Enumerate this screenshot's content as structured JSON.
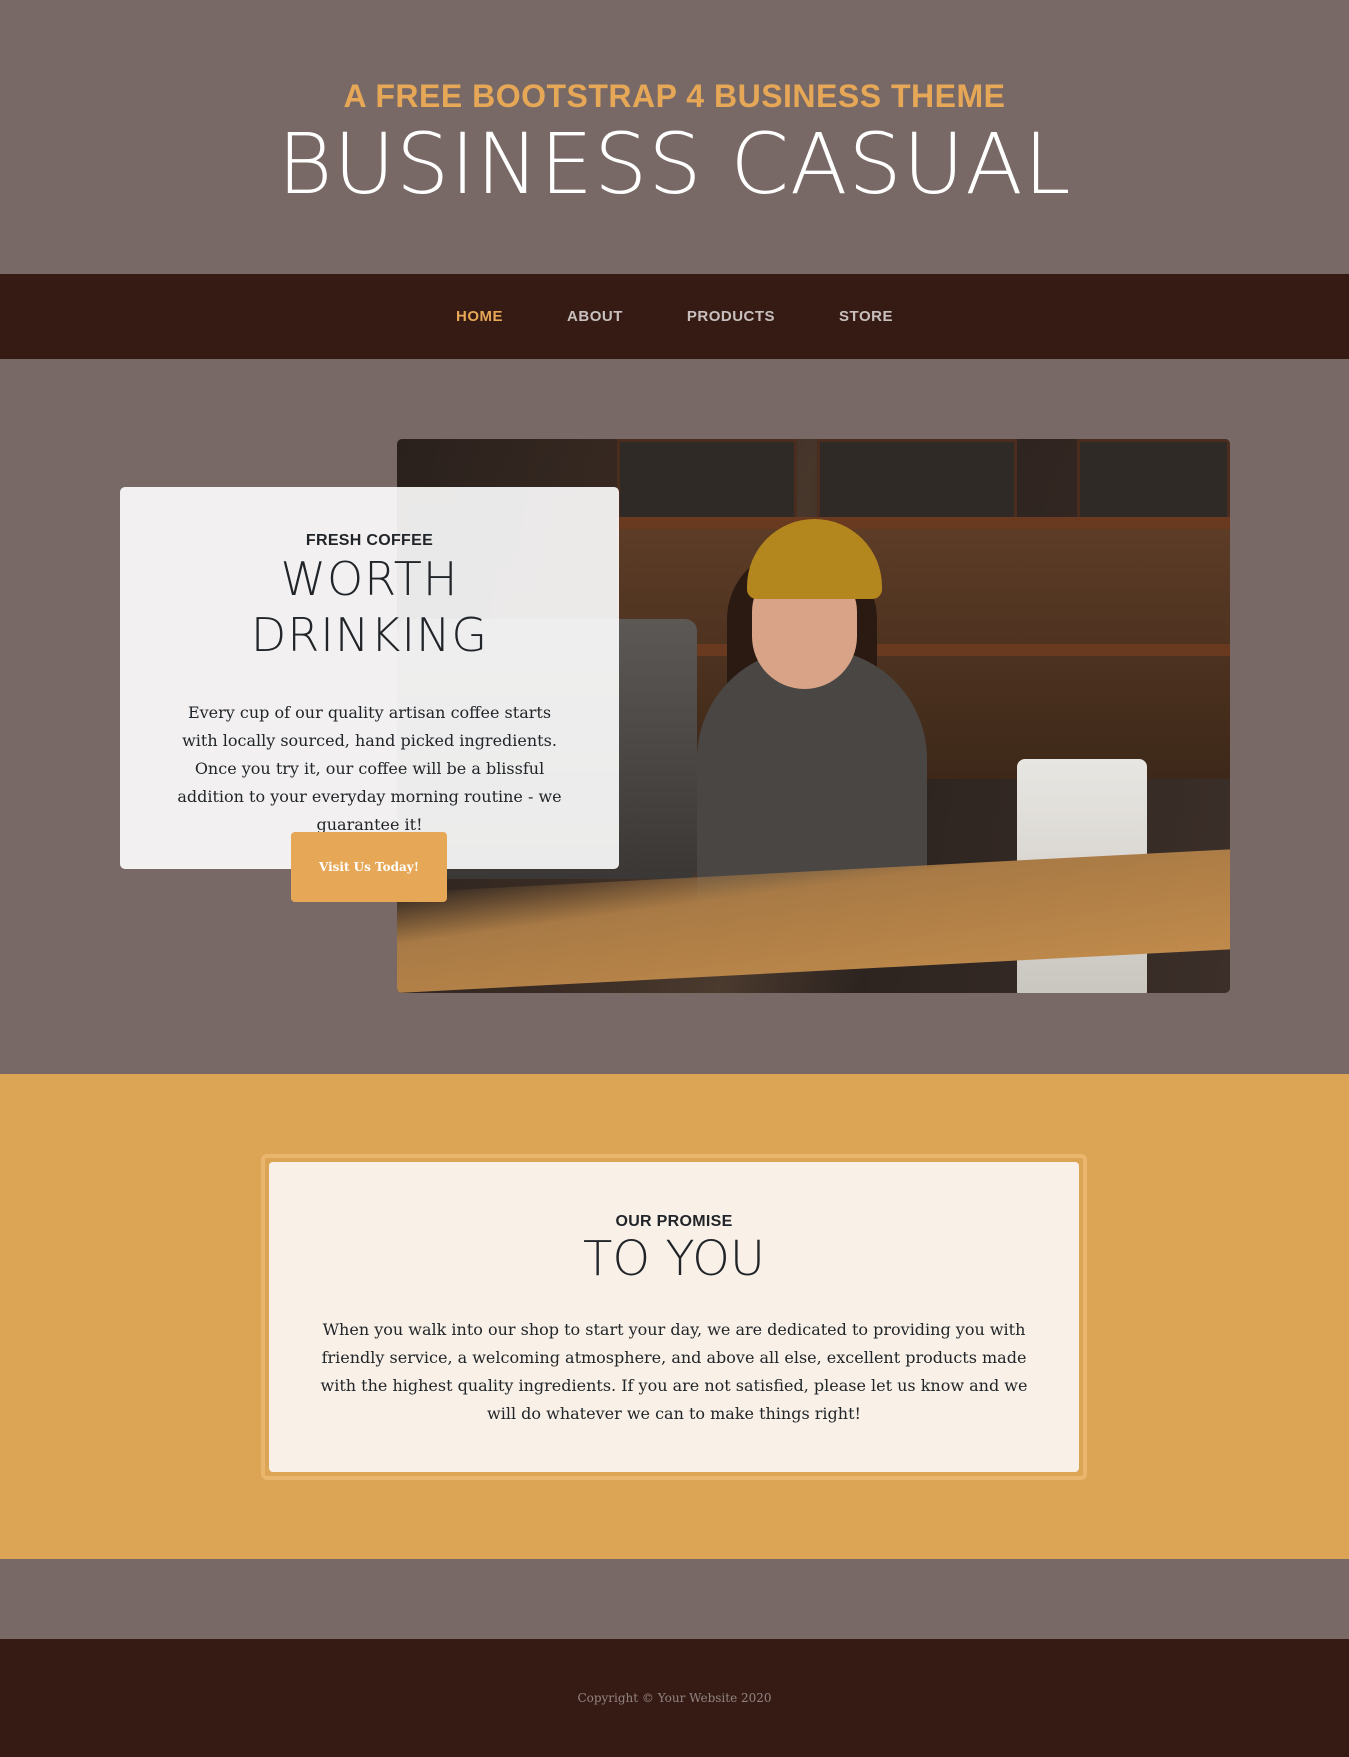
{
  "header": {
    "subtitle": "A FREE BOOTSTRAP 4 BUSINESS THEME",
    "title": "BUSINESS CASUAL"
  },
  "nav": {
    "items": [
      {
        "label": "HOME",
        "active": true
      },
      {
        "label": "ABOUT",
        "active": false
      },
      {
        "label": "PRODUCTS",
        "active": false
      },
      {
        "label": "STORE",
        "active": false
      }
    ]
  },
  "intro": {
    "heading_lower": "FRESH COFFEE",
    "heading_upper_line1": "WORTH",
    "heading_upper_line2": "DRINKING",
    "body": "Every cup of our quality artisan coffee starts with locally sourced, hand picked ingredients. Once you try it, our coffee will be a blissful addition to your everyday morning routine - we guarantee it!",
    "button_label": "Visit Us Today!"
  },
  "promise": {
    "heading_lower": "OUR PROMISE",
    "heading_upper": "TO YOU",
    "body": "When you walk into our shop to start your day, we are dedicated to providing you with friendly service, a welcoming atmosphere, and above all else, excellent products made with the highest quality ingredients. If you are not satisfied, please let us know and we will do whatever we can to make things right!"
  },
  "footer": {
    "copyright": "Copyright © Your Website 2020"
  },
  "colors": {
    "accent": "#e6a756",
    "page_bg": "#786966",
    "nav_bg": "#361b15",
    "promise_bg": "#dca455",
    "promise_card": "#f9f1e7"
  }
}
